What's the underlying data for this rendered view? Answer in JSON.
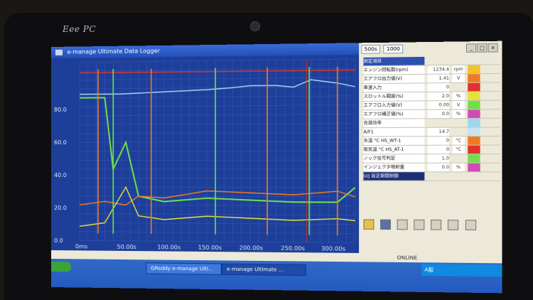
{
  "device": {
    "brand": "Eee PC"
  },
  "window": {
    "title": "e-manage Ultimate Data Logger"
  },
  "colors": {
    "plot_bg": "#1d3f9a",
    "grid": "#3b5bb8",
    "red": "#e0322b",
    "orange": "#f07a24",
    "yellow": "#e6e23a",
    "green": "#6fe04a",
    "cyan": "#9fd6ef",
    "magenta": "#d24bb5"
  },
  "chart_data": {
    "type": "line",
    "title": "",
    "xlabel": "",
    "ylabel": "",
    "x_ticks": [
      "0ms",
      "50.00s",
      "100.00s",
      "150.00s",
      "200.00s",
      "250.00s",
      "300.00s"
    ],
    "y_ticks": [
      "0.0",
      "20.0",
      "40.0",
      "60.0",
      "80.0"
    ],
    "xlim": [
      0,
      320
    ],
    "ylim": [
      0,
      100
    ],
    "grid": true,
    "series": [
      {
        "color": "cyan",
        "x": [
          0,
          50,
          100,
          150,
          180,
          200,
          230,
          250,
          270,
          300,
          320
        ],
        "y": [
          82,
          82,
          83,
          84,
          85,
          86,
          86,
          85,
          89,
          87,
          85
        ]
      },
      {
        "color": "green",
        "x": [
          0,
          30,
          40,
          55,
          70,
          100,
          150,
          200,
          250,
          300,
          320
        ],
        "y": [
          80,
          80,
          40,
          55,
          25,
          22,
          24,
          23,
          22,
          22,
          30
        ]
      },
      {
        "color": "orange",
        "x": [
          0,
          30,
          55,
          70,
          100,
          150,
          200,
          250,
          300,
          320
        ],
        "y": [
          20,
          22,
          20,
          25,
          24,
          28,
          27,
          26,
          28,
          25
        ]
      },
      {
        "color": "yellow",
        "x": [
          0,
          30,
          55,
          70,
          100,
          150,
          200,
          250,
          300,
          320
        ],
        "y": [
          8,
          10,
          30,
          14,
          12,
          14,
          13,
          12,
          13,
          12
        ]
      },
      {
        "color": "red",
        "x": [
          0,
          320
        ],
        "y": [
          94,
          94
        ]
      }
    ]
  },
  "right_panel": {
    "toolbar": [
      "500s",
      "1000"
    ],
    "rows": [
      {
        "label": "測定項目",
        "value": "",
        "unit": "",
        "color": ""
      },
      {
        "label": "エンジン回転数(rpm)",
        "value": "1234.4",
        "unit": "rpm",
        "color": "#f2c12e"
      },
      {
        "label": "エアフロ出力値(V)",
        "value": "1.41",
        "unit": "V",
        "color": "#f07a24"
      },
      {
        "label": "車速入力",
        "value": "0",
        "unit": "",
        "color": "#e0322b"
      },
      {
        "label": "スロットル開度(%)",
        "value": "2.0",
        "unit": "%",
        "color": "#e6e23a"
      },
      {
        "label": "エアフロ入力値(V)",
        "value": "0.00",
        "unit": "V",
        "color": "#6fe04a"
      },
      {
        "label": "エアフロ補正値(%)",
        "value": "0.0",
        "unit": "%",
        "color": "#d24bb5"
      },
      {
        "label": "充填効率",
        "value": "",
        "unit": "",
        "color": "#9fd6ef"
      },
      {
        "label": "A/F1",
        "value": "14.7",
        "unit": "",
        "color": "#c6e3f0"
      },
      {
        "label": "水温 °C HS_WT-1",
        "value": "0",
        "unit": "°C",
        "color": "#f07a24"
      },
      {
        "label": "吸気温 °C HS_AT-1",
        "value": "0",
        "unit": "°C",
        "color": "#e0322b"
      },
      {
        "label": "ノック信号判定",
        "value": "1.0",
        "unit": "",
        "color": "#6fe04a"
      },
      {
        "label": "インジェクタ噴射量",
        "value": "0.0",
        "unit": "%",
        "color": "#d24bb5"
      },
      {
        "label": "U/J 設定期間制御",
        "value": "",
        "unit": "",
        "color": ""
      }
    ]
  },
  "status": {
    "online": "ONLINE"
  },
  "taskbar": {
    "items": [
      "GReddy e-manage Ulti...",
      "e-manage Ultimate ..."
    ],
    "tray_text": "A般"
  }
}
